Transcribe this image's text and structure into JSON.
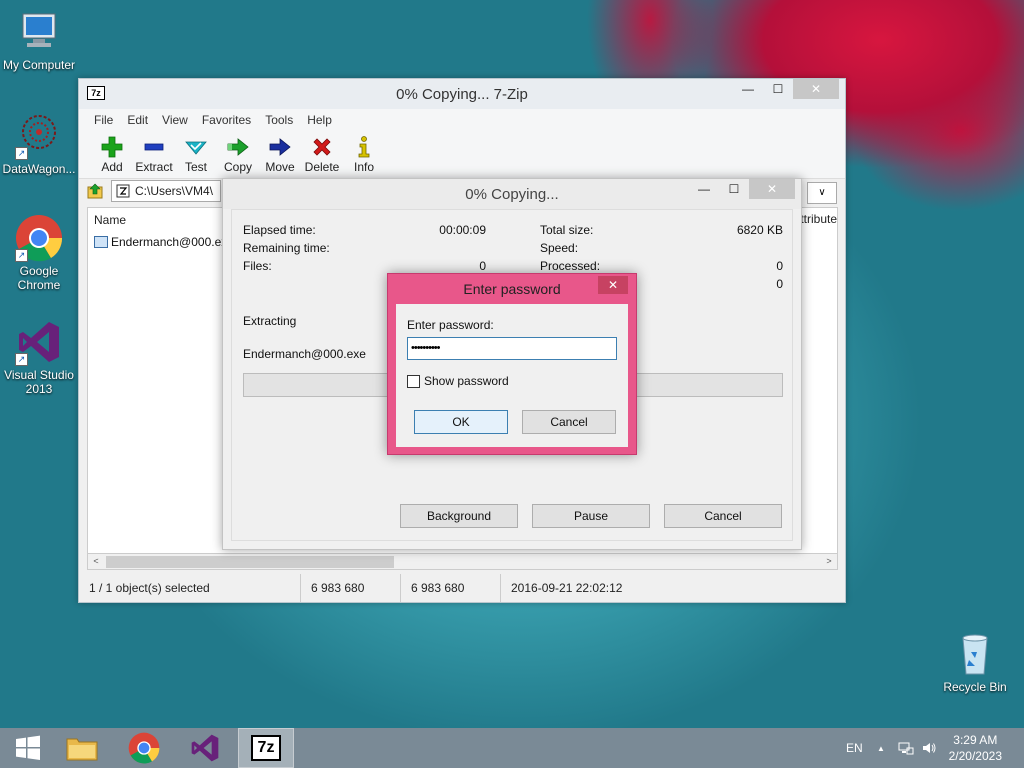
{
  "desktop": {
    "icons": [
      {
        "label": "My Computer"
      },
      {
        "label": "DataWagon..."
      },
      {
        "label": "Google Chrome"
      },
      {
        "label": "Visual Studio 2013"
      },
      {
        "label": "Recycle Bin"
      }
    ]
  },
  "main_window": {
    "title": "0% Copying... 7-Zip",
    "app_icon_text": "7z",
    "controls": {
      "minimize": "—",
      "maximize": "☐",
      "close": "✕"
    },
    "menu": [
      "File",
      "Edit",
      "View",
      "Favorites",
      "Tools",
      "Help"
    ],
    "toolbar": [
      {
        "label": "Add",
        "icon": "plus-icon",
        "color": "#1aa31a"
      },
      {
        "label": "Extract",
        "icon": "minus-icon",
        "color": "#1f3fbf"
      },
      {
        "label": "Test",
        "icon": "check-icon",
        "color": "#19b3c6"
      },
      {
        "label": "Copy",
        "icon": "copy-arrow-icon",
        "color": "#1ba02c"
      },
      {
        "label": "Move",
        "icon": "move-arrow-icon",
        "color": "#1a2f9e"
      },
      {
        "label": "Delete",
        "icon": "x-icon",
        "color": "#d11a1a"
      },
      {
        "label": "Info",
        "icon": "info-icon",
        "color": "#d6c200"
      }
    ],
    "address": {
      "path": "C:\\Users\\VM4\\",
      "dropdown": "∨"
    },
    "file_list": {
      "columns": [
        "Name",
        "ttribute"
      ],
      "rows": [
        {
          "name": "Endermanch@000.exe"
        }
      ]
    },
    "scroll": {
      "left": "<",
      "right": ">"
    },
    "status": {
      "selected": "1 / 1 object(s) selected",
      "size": "6 983 680",
      "packed": "6 983 680",
      "modified": "2016-09-21 22:02:12"
    }
  },
  "copy_dialog": {
    "title": "0% Copying...",
    "controls": {
      "minimize": "—",
      "maximize": "☐",
      "close": "✕"
    },
    "stats": {
      "elapsed_label": "Elapsed time:",
      "elapsed_value": "00:00:09",
      "remaining_label": "Remaining time:",
      "files_label": "Files:",
      "files_value": "0",
      "total_size_label": "Total size:",
      "total_size_value": "6820 KB",
      "speed_label": "Speed:",
      "processed_label": "Processed:",
      "processed_value": "0",
      "extra_value": "0"
    },
    "operation": "Extracting",
    "current_file": "Endermanch@000.exe",
    "progress": 0,
    "buttons": {
      "background": "Background",
      "pause": "Pause",
      "cancel": "Cancel"
    }
  },
  "password_dialog": {
    "title": "Enter password",
    "close": "✕",
    "label": "Enter password:",
    "value": "••••••••••",
    "show_password": "Show password",
    "ok": "OK",
    "cancel": "Cancel"
  },
  "taskbar": {
    "language": "EN",
    "time": "3:29 AM",
    "date": "2/20/2023",
    "tray_arrow": "▲",
    "active_app": "7z"
  }
}
